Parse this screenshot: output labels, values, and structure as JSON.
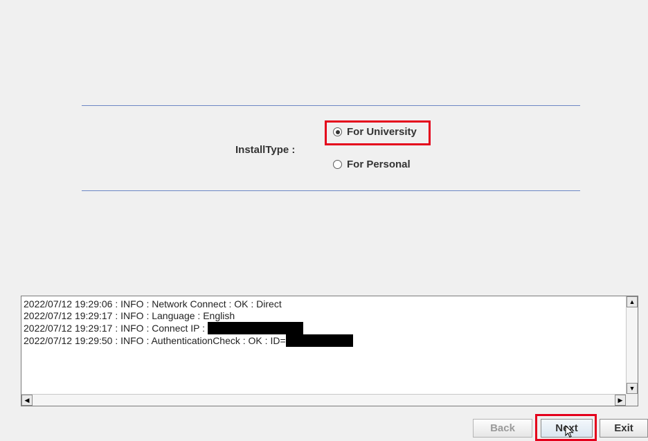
{
  "install_type": {
    "label": "InstallType :",
    "options": [
      {
        "label": "For University",
        "selected": true
      },
      {
        "label": "For Personal",
        "selected": false
      }
    ]
  },
  "log": {
    "lines": [
      "2022/07/12 19:29:06 : INFO  : Network Connect : OK : Direct",
      "2022/07/12 19:29:17 : INFO  : Language : English",
      "2022/07/12 19:29:17 : INFO  : Connect IP : ",
      "2022/07/12 19:29:50 : INFO  : AuthenticationCheck : OK : ID="
    ]
  },
  "buttons": {
    "back": "Back",
    "next": "Next",
    "exit": "Exit"
  },
  "colors": {
    "highlight": "#e4001b",
    "rule": "#6b86c4",
    "background": "#f0f0f0"
  },
  "icons": {
    "scroll_up": "arrow-up-icon",
    "scroll_down": "arrow-down-icon",
    "scroll_left": "arrow-left-icon",
    "scroll_right": "arrow-right-icon",
    "cursor": "pointer-cursor-icon"
  }
}
